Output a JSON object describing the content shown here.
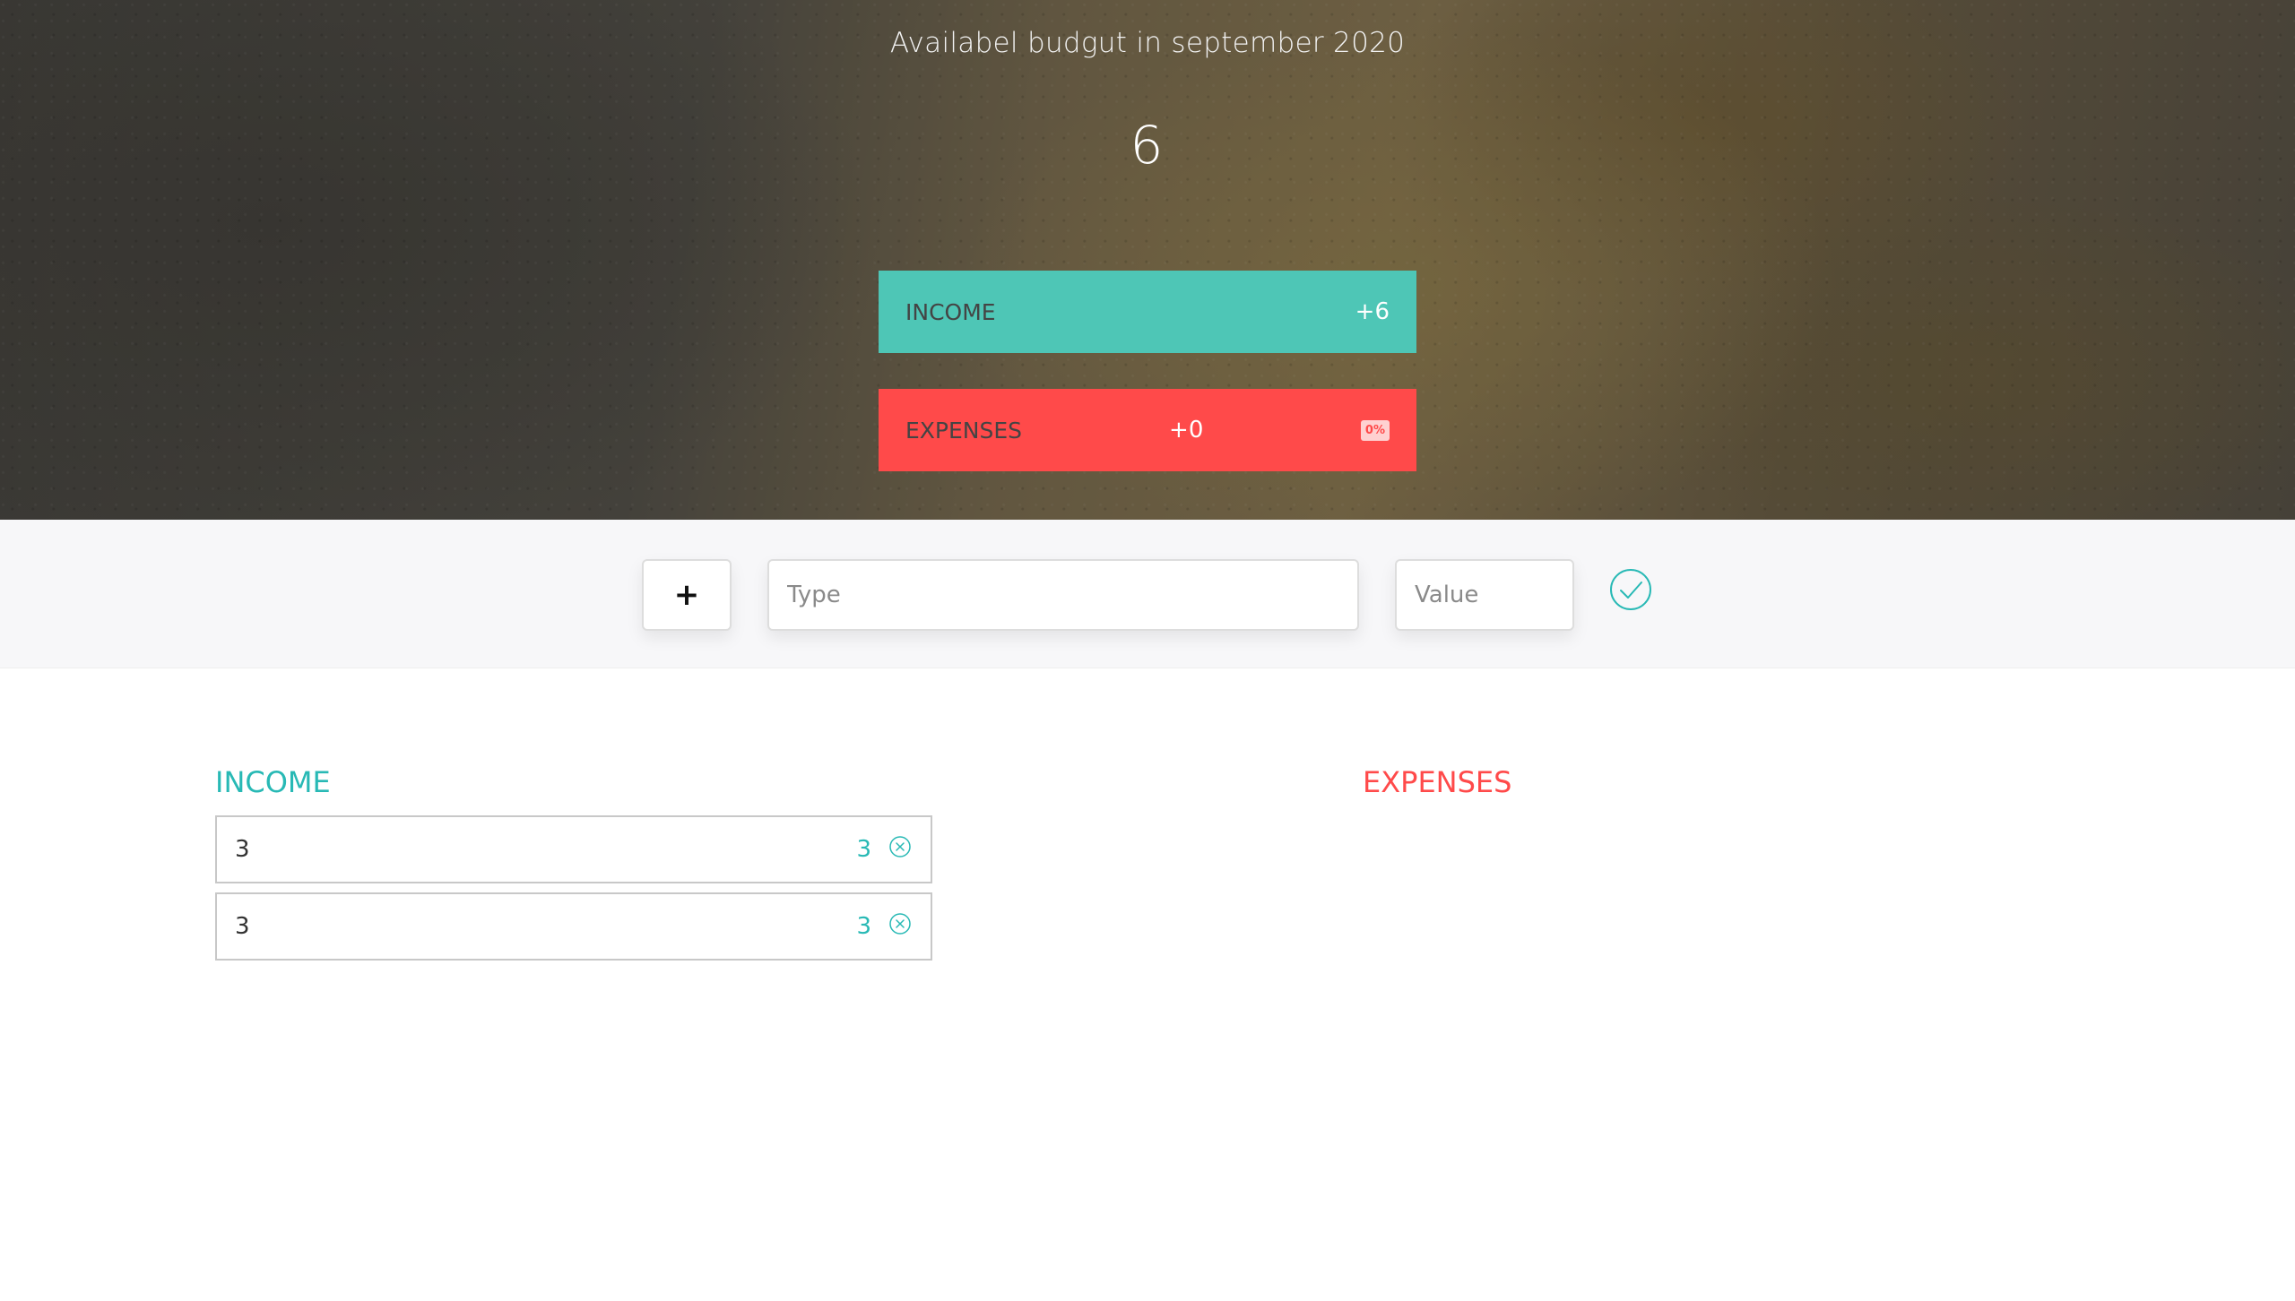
{
  "budget": {
    "title": "Availabel budgut in september 2020",
    "value": "6",
    "income_label": "Income",
    "income_value": "+6",
    "expenses_label": "Expenses",
    "expenses_value": "+0",
    "expenses_percentage": "0%"
  },
  "add_form": {
    "type_button": "+",
    "description_placeholder": "Type",
    "value_placeholder": "Value",
    "submit_icon": "check-circle-icon"
  },
  "income": {
    "title": "Income",
    "items": [
      {
        "description": "3",
        "value": "3",
        "delete_icon": "close-circle-icon"
      },
      {
        "description": "3",
        "value": "3",
        "delete_icon": "close-circle-icon"
      }
    ]
  },
  "expenses": {
    "title": "Expenses",
    "items": []
  },
  "colors": {
    "income": "#28b9b5",
    "income_bar": "#4ec6b6",
    "expenses": "#ff4a4a"
  }
}
